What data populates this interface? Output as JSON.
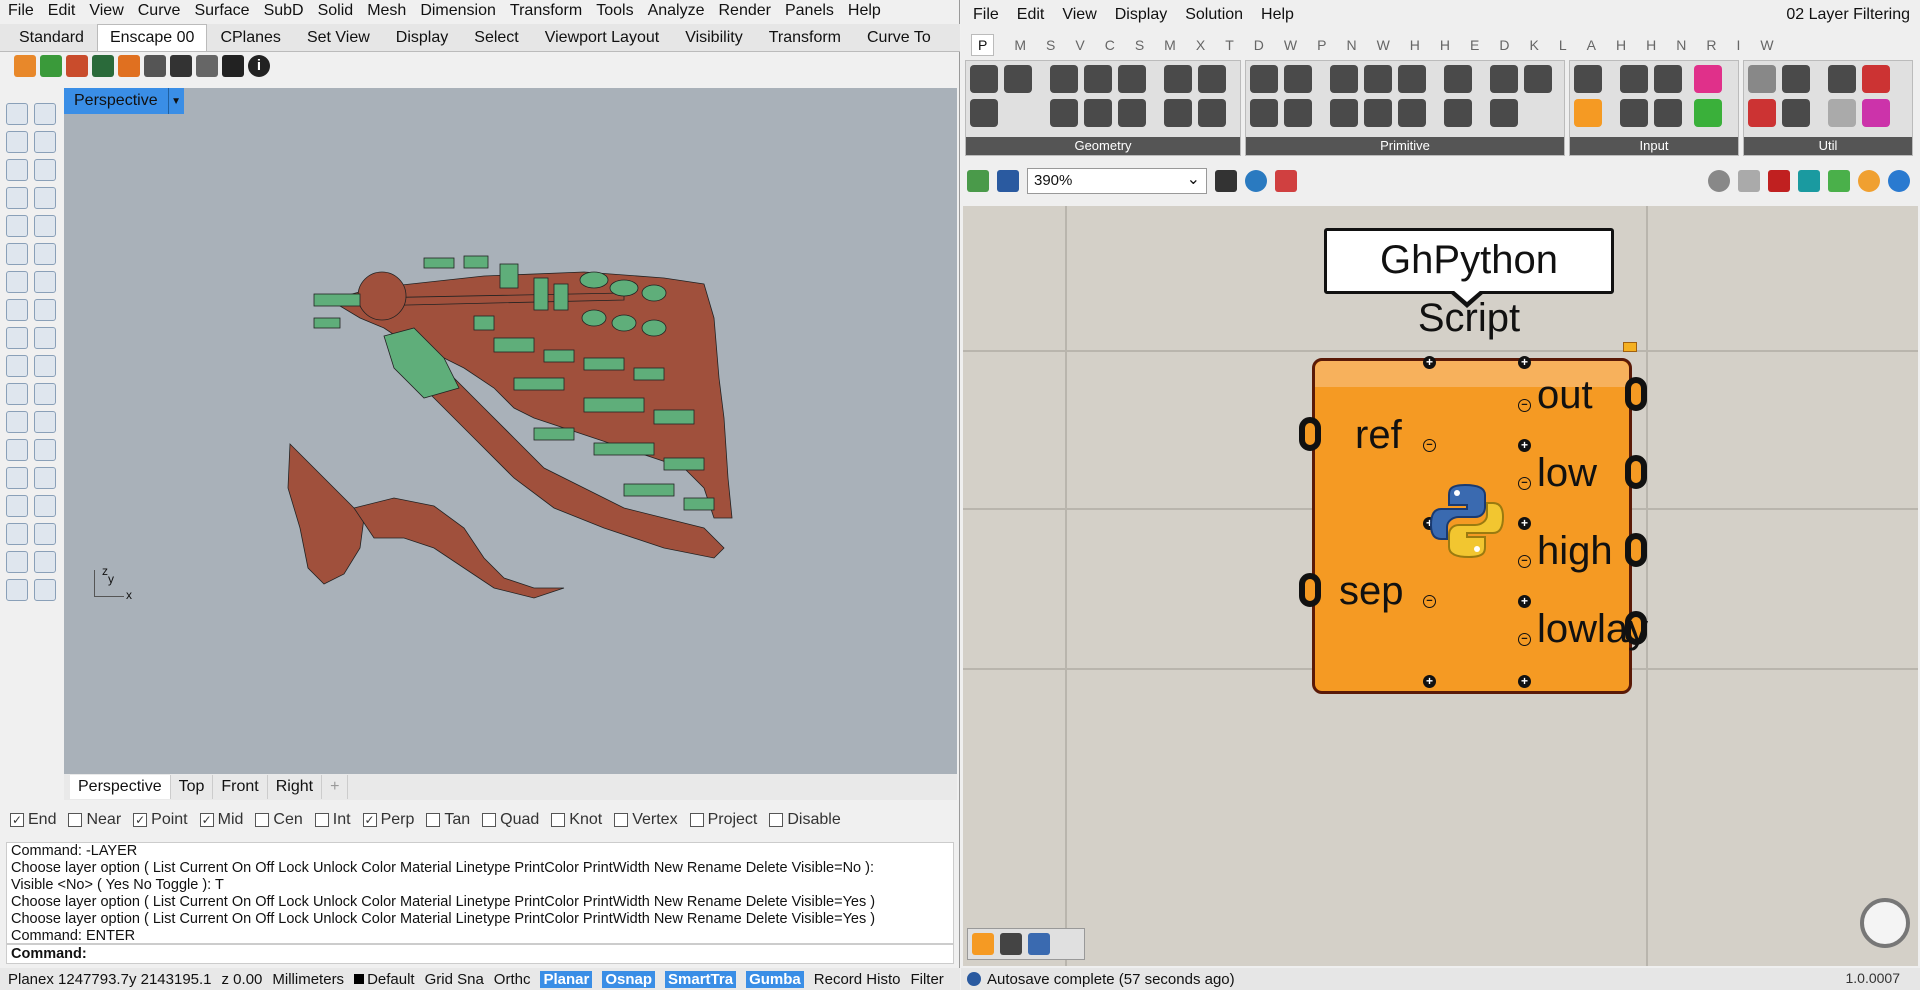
{
  "rhino": {
    "menu": [
      "File",
      "Edit",
      "View",
      "Curve",
      "Surface",
      "SubD",
      "Solid",
      "Mesh",
      "Dimension",
      "Transform",
      "Tools",
      "Analyze",
      "Render",
      "Panels",
      "Help"
    ],
    "tabs": [
      "Standard",
      "Enscape 00",
      "CPlanes",
      "Set View",
      "Display",
      "Select",
      "Viewport Layout",
      "Visibility",
      "Transform",
      "Curve To"
    ],
    "active_tab": "Enscape 00",
    "viewport_title": "Perspective",
    "viewport_tabs": [
      "Perspective",
      "Top",
      "Front",
      "Right"
    ],
    "axis_labels": {
      "z": "z",
      "y": "y",
      "x": "x"
    },
    "osnaps": [
      {
        "label": "End",
        "checked": true
      },
      {
        "label": "Near",
        "checked": false
      },
      {
        "label": "Point",
        "checked": true
      },
      {
        "label": "Mid",
        "checked": true
      },
      {
        "label": "Cen",
        "checked": false
      },
      {
        "label": "Int",
        "checked": false
      },
      {
        "label": "Perp",
        "checked": true
      },
      {
        "label": "Tan",
        "checked": false
      },
      {
        "label": "Quad",
        "checked": false
      },
      {
        "label": "Knot",
        "checked": false
      },
      {
        "label": "Vertex",
        "checked": false
      },
      {
        "label": "Project",
        "checked": false
      },
      {
        "label": "Disable",
        "checked": false
      }
    ],
    "command_history": [
      "Command: -LAYER",
      "Choose layer option ( List  Current  On  Off  Lock  Unlock  Color  Material  Linetype  PrintColor  PrintWidth  New  Rename  Delete  Visible=No ):",
      "Visible <No> ( Yes  No  Toggle ): T",
      "Choose layer option ( List  Current  On  Off  Lock  Unlock  Color  Material  Linetype  PrintColor  PrintWidth  New  Rename  Delete  Visible=Yes )",
      "Choose layer option ( List  Current  On  Off  Lock  Unlock  Color  Material  Linetype  PrintColor  PrintWidth  New  Rename  Delete  Visible=Yes )",
      "Command: ENTER"
    ],
    "command_prompt": "Command:",
    "status": {
      "cplane": "Planex 1247793.7y 2143195.1",
      "z": "z 0.00",
      "units": "Millimeters",
      "layer": "Default",
      "grid": "Grid Sna",
      "ortho": "Orthc",
      "planar": "Planar",
      "osnap": "Osnap",
      "smarttrack": "SmartTra",
      "gumball": "Gumba",
      "record": "Record Histo",
      "filter": "Filter"
    },
    "colors": {
      "roads": "#a0503c",
      "buildings": "#5fae7a",
      "viewport_bg": "#a9b1b9",
      "accent": "#3a8ee6"
    }
  },
  "gh": {
    "menu": [
      "File",
      "Edit",
      "View",
      "Display",
      "Solution",
      "Help"
    ],
    "title": "02 Layer Filtering",
    "category_tabs": [
      "P",
      "M",
      "S",
      "V",
      "C",
      "S",
      "M",
      "X",
      "T",
      "D",
      "W",
      "P",
      "N",
      "W",
      "H",
      "H",
      "E",
      "D",
      "K",
      "L",
      "A",
      "H",
      "H",
      "N",
      "R",
      "I",
      "W"
    ],
    "panels": [
      "Geometry",
      "Primitive",
      "Input",
      "Util"
    ],
    "zoom": "390%",
    "bubble_text": "GhPython Script",
    "inputs": [
      "ref",
      "sep"
    ],
    "outputs": [
      "out",
      "low",
      "high",
      "lowlay"
    ],
    "status": "Autosave complete (57 seconds ago)",
    "version": "1.0.0007",
    "colors": {
      "component": "#f59a23",
      "canvas": "#d4d0c8"
    }
  }
}
